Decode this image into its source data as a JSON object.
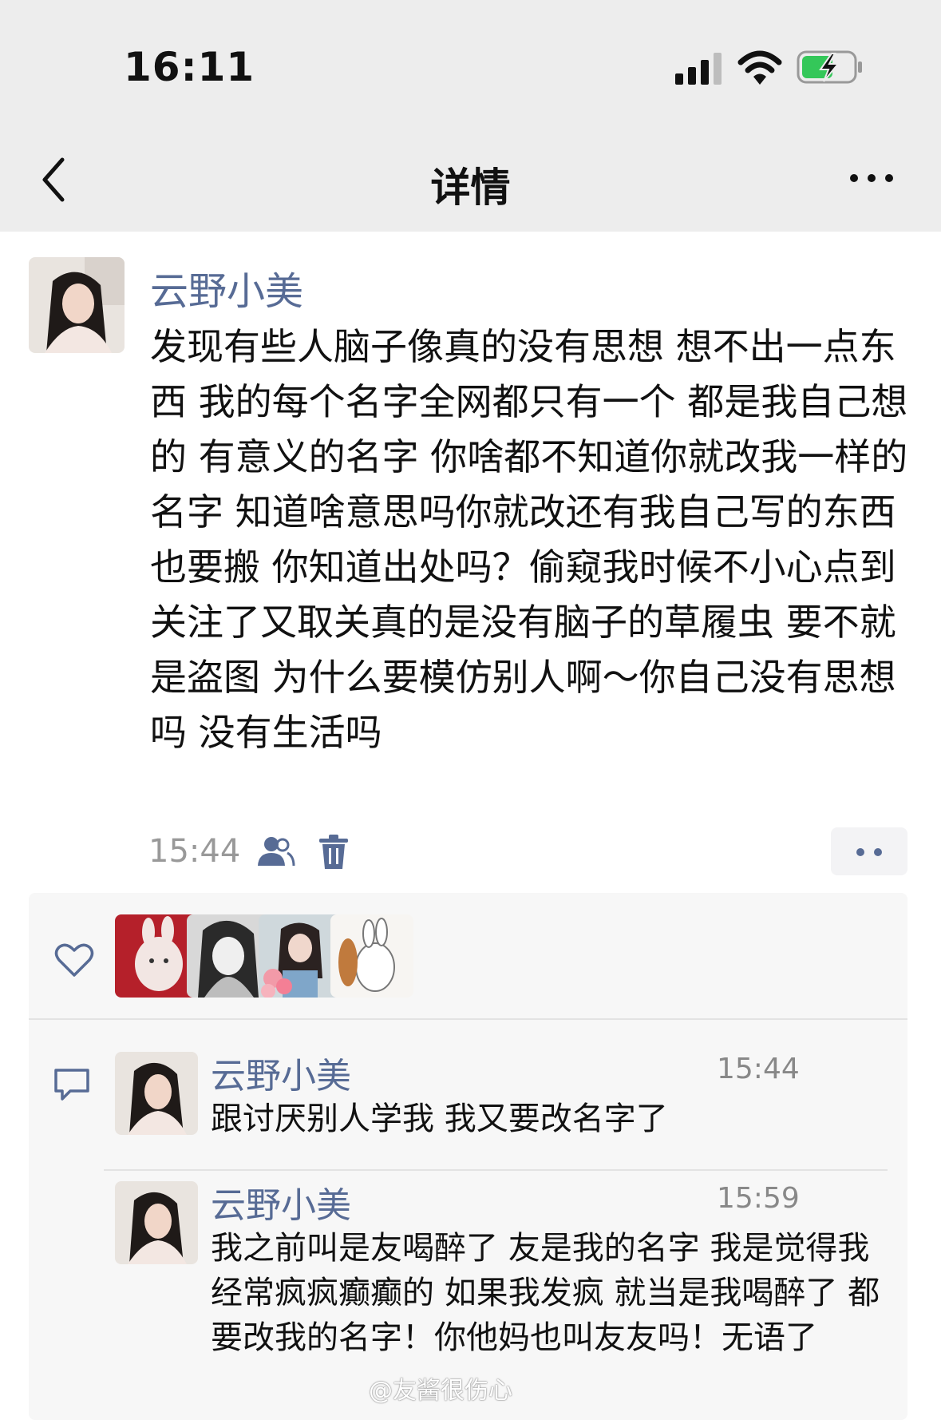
{
  "status_bar": {
    "time": "16:11"
  },
  "nav": {
    "title": "详情"
  },
  "post": {
    "author": "云野小美",
    "body": "发现有些人脑子像真的没有思想 想不出一点东西 我的每个名字全网都只有一个 都是我自己想的 有意义的名字 你啥都不知道你就改我一样的名字 知道啥意思吗你就改还有我自己写的东西也要搬 你知道出处吗？偷窥我时候不小心点到关注了又取关真的是没有脑子的草履虫 要不就是盗图 为什么要模仿别人啊～你自己没有思想吗 没有生活吗",
    "time": "15:44"
  },
  "comments": [
    {
      "author": "云野小美",
      "time": "15:44",
      "text": "跟讨厌别人学我 我又要改名字了"
    },
    {
      "author": "云野小美",
      "time": "15:59",
      "text": "我之前叫是友喝醉了 友是我的名字 我是觉得我经常疯疯癫癫的 如果我发疯 就当是我喝醉了 都要改我的名字！你他妈也叫友友吗！无语了"
    }
  ],
  "watermark": "@友酱很伤心",
  "icons": [
    "back-icon",
    "more-icon",
    "friends-icon",
    "delete-icon",
    "heart-icon",
    "comment-icon",
    "signal-icon",
    "wifi-icon",
    "battery-icon"
  ],
  "colors": {
    "name_blue": "#576b95",
    "nav_bg": "#ededed",
    "battery_green": "#34c759"
  }
}
